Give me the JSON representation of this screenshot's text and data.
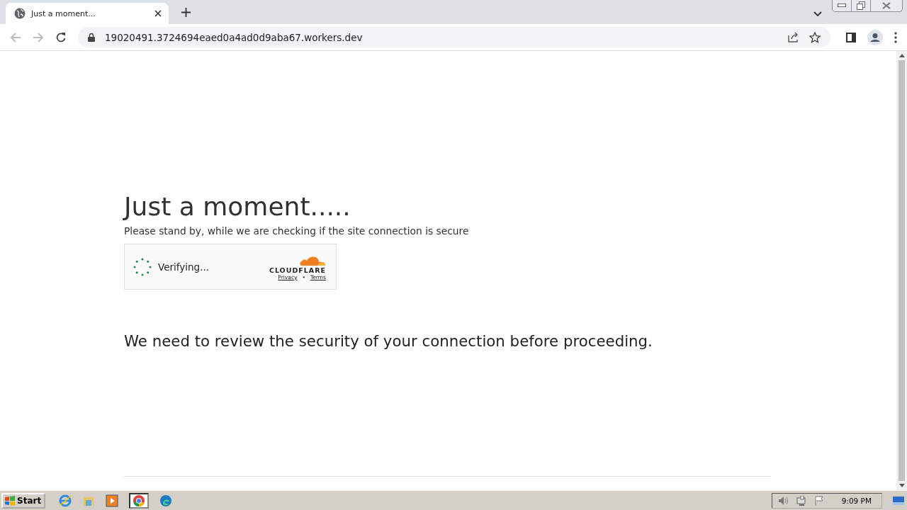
{
  "browser": {
    "tab": {
      "title": "Just a moment..."
    },
    "address": "19020491.3724694eaed0a4ad0d9aba67.workers.dev"
  },
  "page": {
    "heading": "Just a moment.....",
    "subtitle": "Please stand by, while we are checking if the site connection is secure",
    "widget": {
      "status": "Verifying...",
      "brand": "CLOUDFLARE",
      "links": [
        "Privacy",
        "Terms"
      ],
      "separator": "•"
    },
    "message": "We need to review the security of your connection before proceeding."
  },
  "taskbar": {
    "start": "Start",
    "clock": "9:09 PM"
  }
}
